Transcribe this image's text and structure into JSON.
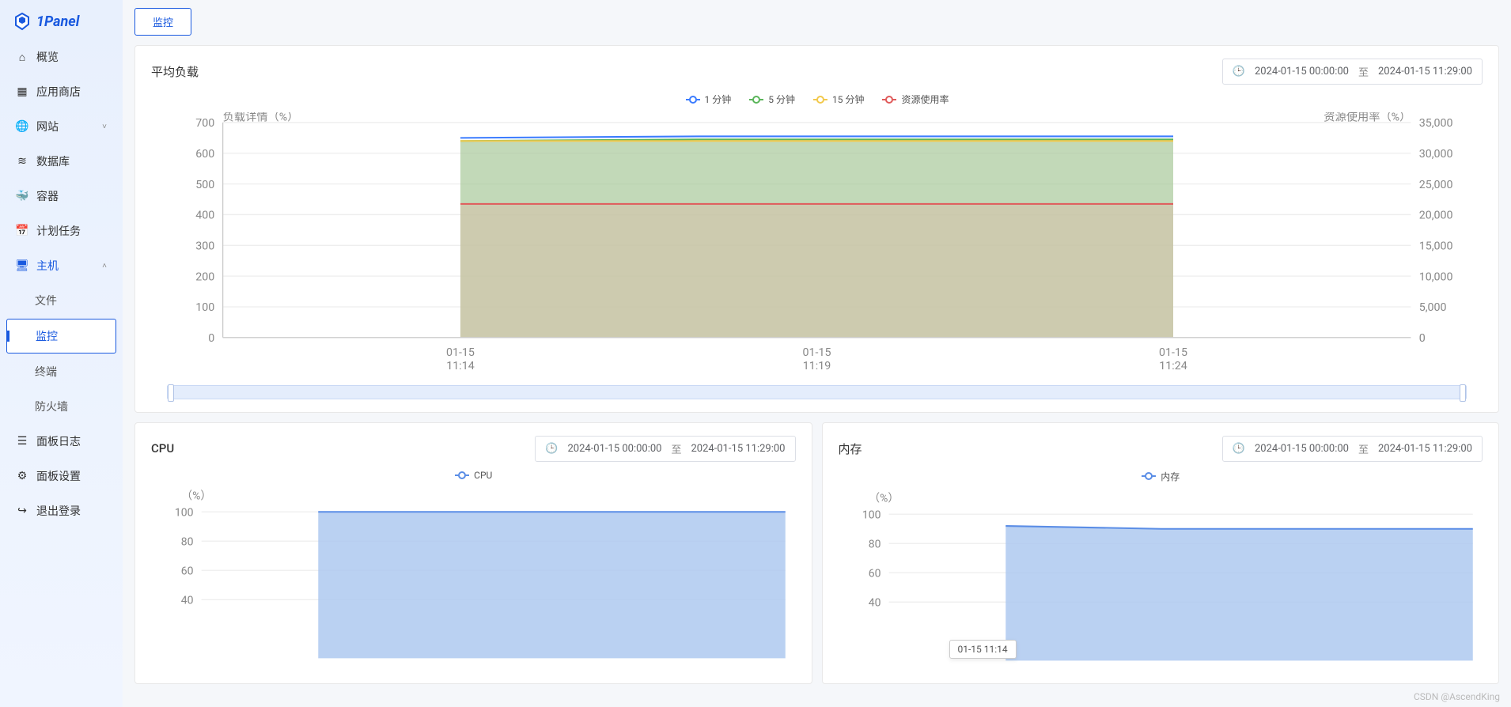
{
  "brand": "1Panel",
  "tab": {
    "monitor": "监控"
  },
  "sidebar": {
    "items": [
      {
        "label": "概览",
        "icon": "home"
      },
      {
        "label": "应用商店",
        "icon": "grid"
      },
      {
        "label": "网站",
        "icon": "globe",
        "chev": true
      },
      {
        "label": "数据库",
        "icon": "db"
      },
      {
        "label": "容器",
        "icon": "docker"
      },
      {
        "label": "计划任务",
        "icon": "sched"
      },
      {
        "label": "主机",
        "icon": "host",
        "chev": true,
        "active": true,
        "children": [
          {
            "label": "文件"
          },
          {
            "label": "监控",
            "selected": true
          },
          {
            "label": "终端"
          },
          {
            "label": "防火墙"
          }
        ]
      },
      {
        "label": "面板日志",
        "icon": "log"
      },
      {
        "label": "面板设置",
        "icon": "gear"
      },
      {
        "label": "退出登录",
        "icon": "exit"
      }
    ]
  },
  "daterange": {
    "from": "2024-01-15 00:00:00",
    "sep": "至",
    "to": "2024-01-15 11:29:00"
  },
  "chart_data": [
    {
      "id": "load",
      "title": "平均负载",
      "type": "area",
      "left_axis": "负载详情（%）",
      "right_axis": "资源使用率（%）",
      "left_ticks": [
        0,
        100,
        200,
        300,
        400,
        500,
        600,
        700
      ],
      "right_ticks": [
        0,
        5000,
        10000,
        15000,
        20000,
        25000,
        30000,
        35000
      ],
      "x_labels": [
        "01-15\n11:14",
        "01-15\n11:19",
        "01-15\n11:24"
      ],
      "legend": [
        {
          "name": "1 分钟",
          "color": "#3b7cff"
        },
        {
          "name": "5 分钟",
          "color": "#5ab55a"
        },
        {
          "name": "15 分钟",
          "color": "#f2c94c"
        },
        {
          "name": "资源使用率",
          "color": "#e05a5a"
        }
      ],
      "series": [
        {
          "name": "1 分钟",
          "values": [
            650,
            655,
            655,
            655
          ]
        },
        {
          "name": "5 分钟",
          "values": [
            640,
            645,
            645,
            645
          ]
        },
        {
          "name": "15 分钟",
          "values": [
            640,
            640,
            640,
            640
          ]
        },
        {
          "name": "资源使用率",
          "values": [
            435,
            435,
            435,
            435
          ]
        }
      ],
      "ylim": [
        0,
        700
      ]
    },
    {
      "id": "cpu",
      "title": "CPU",
      "type": "area",
      "axis_label": "（%）",
      "legend": [
        {
          "name": "CPU",
          "color": "#5a8de6"
        }
      ],
      "y_ticks": [
        40,
        60,
        80,
        100
      ],
      "series": [
        {
          "name": "CPU",
          "values": [
            100,
            100,
            100,
            100
          ]
        }
      ],
      "ylim": [
        0,
        110
      ]
    },
    {
      "id": "mem",
      "title": "内存",
      "type": "area",
      "axis_label": "（%）",
      "legend": [
        {
          "name": "内存",
          "color": "#5a8de6"
        }
      ],
      "y_ticks": [
        40,
        60,
        80,
        100
      ],
      "series": [
        {
          "name": "内存",
          "values": [
            92,
            90,
            90,
            90
          ]
        }
      ],
      "tooltip": "01-15 11:14",
      "ylim": [
        0,
        110
      ]
    }
  ],
  "watermark": "CSDN @AscendKing"
}
